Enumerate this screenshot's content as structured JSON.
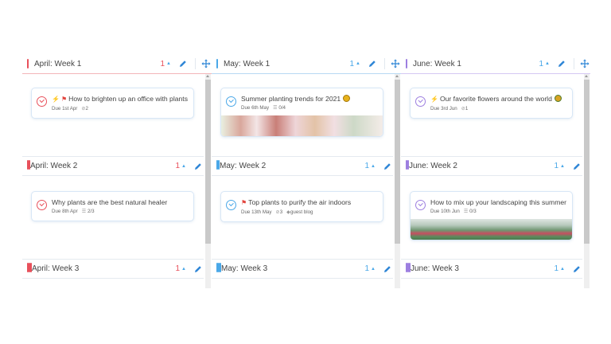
{
  "colors": {
    "red": "#e8505b",
    "blue": "#4aa8e8",
    "purple": "#9d7fe0",
    "accent": "#2f86d6"
  },
  "icons": {
    "edit": "pencil-icon",
    "move": "move-arrows-icon",
    "attachment": "paperclip-icon",
    "checklist": "checklist-icon",
    "tag": "tag-icon"
  },
  "columns": [
    {
      "sections": [
        {
          "title": "April: Week 1",
          "count": "1",
          "card": {
            "title": "How to brighten up an office with plants",
            "due": "Due 1st Apr",
            "attachments": "2"
          }
        },
        {
          "title": "April: Week 2",
          "count": "1",
          "card": {
            "title": "Why plants are the best natural healer",
            "due": "Due 8th Apr",
            "checklist": "2/3"
          }
        },
        {
          "title": "April: Week 3",
          "count": "1"
        }
      ]
    },
    {
      "sections": [
        {
          "title": "May: Week 1",
          "count": "1",
          "card": {
            "title": "Summer planting trends for 2021",
            "due": "Due 6th May",
            "checklist": "0/4"
          }
        },
        {
          "title": "May: Week 2",
          "count": "1",
          "card": {
            "title": "Top plants to purify the air indoors",
            "due": "Due 13th May",
            "attachments": "3",
            "tag": "guest blog"
          }
        },
        {
          "title": "May: Week 3",
          "count": "1"
        }
      ]
    },
    {
      "sections": [
        {
          "title": "June: Week 1",
          "count": "1",
          "card": {
            "title": "Our favorite flowers around the world",
            "due": "Due 3rd Jun",
            "attachments": "1"
          }
        },
        {
          "title": "June: Week 2",
          "count": "1",
          "card": {
            "title": "How to mix up your landscaping this summer",
            "due": "Due 10th Jun",
            "checklist": "0/3"
          }
        },
        {
          "title": "June: Week 3",
          "count": "1"
        }
      ]
    }
  ]
}
